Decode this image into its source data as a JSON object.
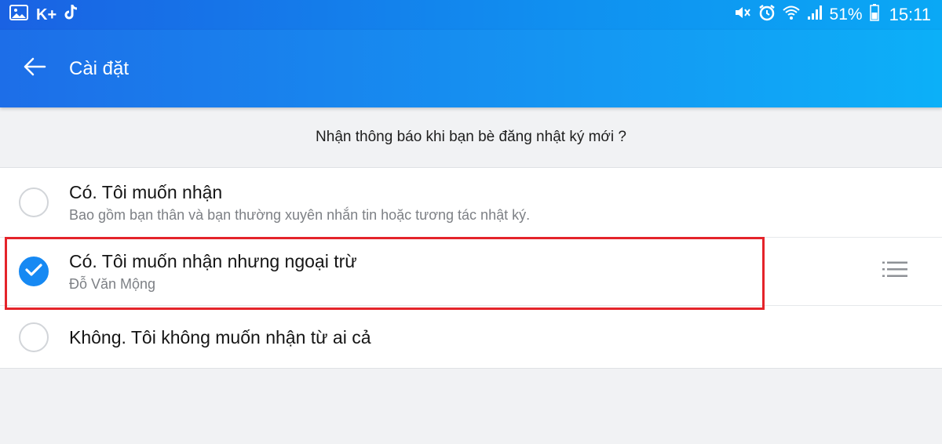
{
  "status_bar": {
    "app_label": "K+",
    "battery": "51%",
    "time": "15:11"
  },
  "header": {
    "title": "Cài đặt"
  },
  "question": "Nhận thông báo khi bạn bè đăng nhật ký mới ?",
  "options": [
    {
      "title": "Có. Tôi muốn nhận",
      "subtitle": "Bao gồm bạn thân và bạn thường xuyên nhắn tin hoặc tương tác nhật ký.",
      "selected": false
    },
    {
      "title": "Có. Tôi muốn nhận nhưng ngoại trừ",
      "subtitle": "Đỗ Văn Mộng",
      "selected": true
    },
    {
      "title": "Không. Tôi không muốn nhận từ ai cả",
      "selected": false
    }
  ],
  "colors": {
    "accent": "#1689f3",
    "highlight": "#e4242a"
  }
}
